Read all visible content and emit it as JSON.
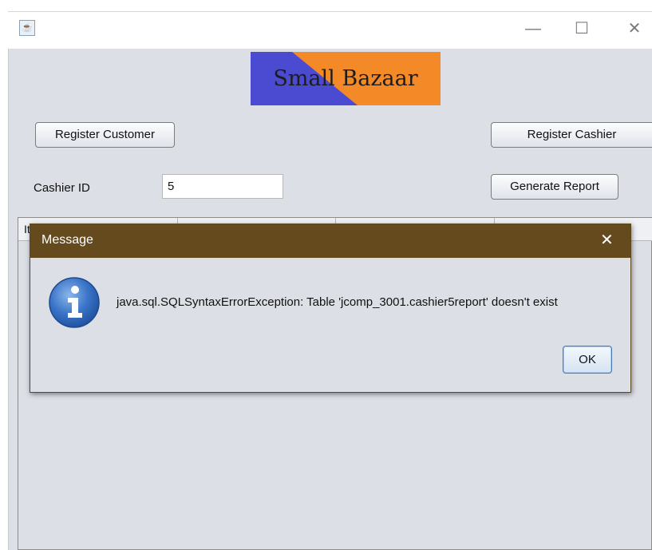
{
  "window": {
    "controls": {
      "minimize": "—",
      "maximize": "☐",
      "close": "✕"
    }
  },
  "logo": {
    "text": "Small Bazaar",
    "colors": {
      "left": "#4a4bd0",
      "right": "#f48a27"
    }
  },
  "buttons": {
    "register_customer": "Register Customer",
    "register_cashier": "Register Cashier",
    "generate_report": "Generate Report"
  },
  "cashier": {
    "label": "Cashier ID",
    "value": "5"
  },
  "table": {
    "first_header_partial": "It"
  },
  "dialog": {
    "title": "Message",
    "close": "✕",
    "icon": "info-icon",
    "message": "java.sql.SQLSyntaxErrorException: Table 'jcomp_3001.cashier5report' doesn't exist",
    "ok_label": "OK",
    "titlebar_color": "#654a1e"
  }
}
